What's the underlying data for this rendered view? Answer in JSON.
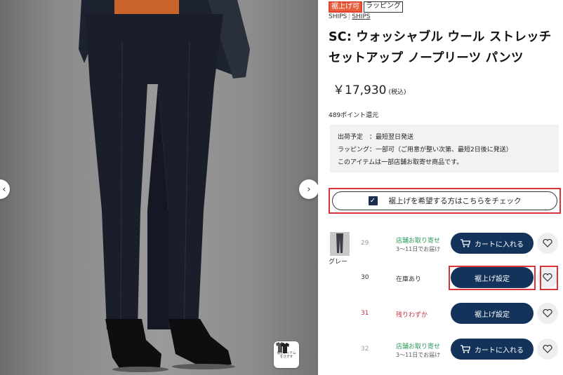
{
  "gallery": {
    "similar_label_1": "似たアイテム",
    "similar_label_2": "をさがす"
  },
  "product": {
    "badges": [
      "裾上げ可",
      "ラッピング"
    ],
    "brand": "SHIPS",
    "brand_link": "SHIPS",
    "title": "SC: ウォッシャブル ウール ストレッチ セットアップ ノープリーツ パンツ",
    "price": "￥17,930",
    "tax_note": "(税込)",
    "points": "489ポイント還元",
    "shipping": {
      "line1": "出荷予定　：最短翌日発送",
      "line2": "ラッピング：一部可（ご用意が整い次第、最短2日後に発送）",
      "line3": "このアイテムは一部店舗お取寄せ商品です。"
    },
    "hemming_check_label": "裾上げを希望する方はこちらをチェック",
    "color_name": "グレー"
  },
  "sizes": [
    {
      "size": "29",
      "stock": "店舗お取り寄せ",
      "stock_sub": "3〜11日でお届け",
      "button": "カートに入れる"
    },
    {
      "size": "30",
      "stock": "在庫あり",
      "stock_sub": "",
      "button": "裾上げ設定"
    },
    {
      "size": "31",
      "stock": "残りわずか",
      "stock_sub": "",
      "button": "裾上げ設定"
    },
    {
      "size": "32",
      "stock": "店舗お取り寄せ",
      "stock_sub": "3〜11日でお届け",
      "button": "カートに入れる"
    }
  ],
  "colors": {
    "navy": "#13335a",
    "highlight_red": "#d9343a",
    "stock_green": "#2c9a5a",
    "stock_red": "#c2334a"
  }
}
